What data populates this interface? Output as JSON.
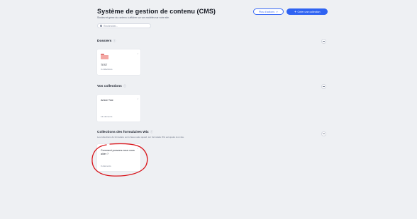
{
  "header": {
    "title": "Système de gestion de contenu (CMS)",
    "subtitle": "Stockez et gérez du contenu à afficher sur vos modèles sur votre site.",
    "more_actions_label": "Plus d'actions",
    "create_collection_label": "Créer une collection"
  },
  "search": {
    "placeholder": "Rechercher..."
  },
  "sections": {
    "folders": {
      "title": "Dossiers",
      "cards": [
        {
          "name": "TEST",
          "meta": "4 collections"
        }
      ]
    },
    "collections": {
      "title": "Vos collections",
      "cards": [
        {
          "name": "Article Test",
          "meta": "13 éléments"
        }
      ]
    },
    "wix_forms": {
      "title": "Collections des formulaires Wix",
      "subtitle": "Les collections du formulaire sont créées auto quand, sur formulaire Wix est ajouté à un site.",
      "cards": [
        {
          "name": "Comment pouvons-nous vous aider ?",
          "meta": "0 éléments"
        }
      ]
    }
  },
  "colors": {
    "accent": "#2f63f2",
    "background": "#eef0f3",
    "folder": "#f3a8a4",
    "annotation": "#d9151b"
  },
  "icons": {
    "search": "search-icon",
    "chevron": "chevron-down-icon",
    "plus": "plus-icon",
    "info": "info-icon",
    "collapse": "minus-icon",
    "folder": "folder-icon",
    "card_menu": "more-icon"
  }
}
